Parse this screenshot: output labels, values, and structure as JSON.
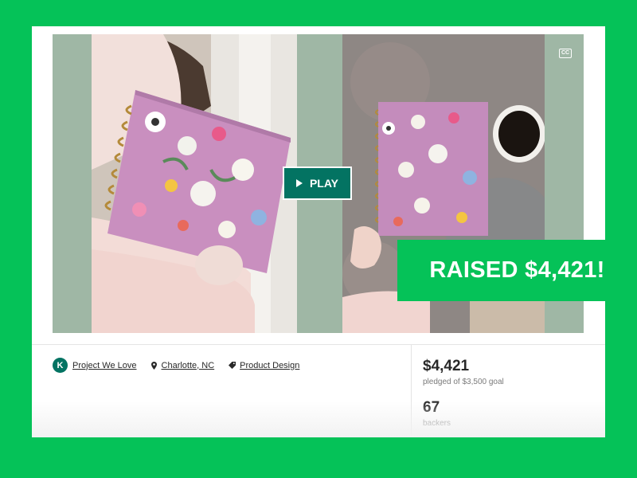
{
  "video": {
    "play_label": "PLAY",
    "cc_label": "CC"
  },
  "meta": {
    "badge_letter": "K",
    "project_we_love": "Project We Love",
    "location": "Charlotte, NC",
    "category": "Product Design"
  },
  "stats": {
    "pledged_amount": "$4,421",
    "pledged_goal": "pledged of $3,500 goal",
    "backers_count": "67",
    "backers_label": "backers"
  },
  "banner": {
    "text": "RAISED $4,421!"
  },
  "colors": {
    "background_green": "#05c258",
    "kickstarter_teal": "#037362",
    "video_backdrop": "#9fb7a5"
  },
  "icons": [
    "kickstarter-badge-icon",
    "location-pin-icon",
    "tag-icon",
    "play-icon",
    "closed-captions-icon"
  ]
}
